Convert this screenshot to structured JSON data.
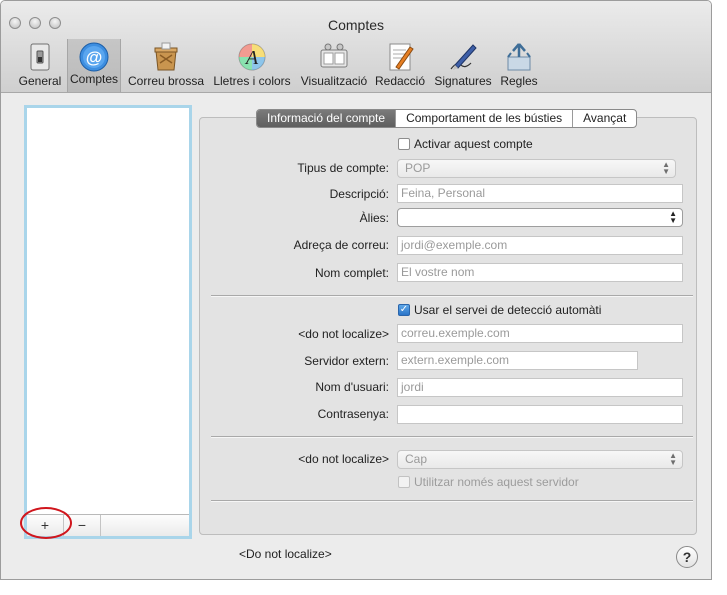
{
  "window": {
    "title": "Comptes"
  },
  "toolbar": {
    "items": [
      {
        "label": "General",
        "icon": "general-switch-icon"
      },
      {
        "label": "Comptes",
        "icon": "at-sign-icon"
      },
      {
        "label": "Correu brossa",
        "icon": "junk-bin-icon"
      },
      {
        "label": "Lletres i colors",
        "icon": "font-color-icon"
      },
      {
        "label": "Visualització",
        "icon": "viewing-icon"
      },
      {
        "label": "Redacció",
        "icon": "composing-icon"
      },
      {
        "label": "Signatures",
        "icon": "signature-pen-icon"
      },
      {
        "label": "Regles",
        "icon": "rules-icon"
      }
    ],
    "active": "Comptes"
  },
  "sidebar": {
    "add_label": "+",
    "remove_label": "−"
  },
  "tabs": {
    "items": [
      "Informació del compte",
      "Comportament de les bústies",
      "Avançat"
    ],
    "selected": "Informació del compte"
  },
  "form": {
    "enable_account_label": "Activar aquest compte",
    "account_type_label": "Tipus de compte:",
    "account_type_value": "POP",
    "description_label": "Descripció:",
    "description_placeholder": "Feina, Personal",
    "alias_label": "Àlies:",
    "alias_value": "",
    "email_label": "Adreça de correu:",
    "email_placeholder": "jordi@exemple.com",
    "fullname_label": "Nom complet:",
    "fullname_placeholder": "El vostre nom",
    "autodetect_label": "Usar el servei de detecció automàti",
    "incoming_label": "<do not localize>",
    "incoming_placeholder": "correu.exemple.com",
    "external_server_label": "Servidor extern:",
    "external_server_placeholder": "extern.exemple.com",
    "username_label": "Nom d'usuari:",
    "username_placeholder": "jordi",
    "password_label": "Contrasenya:",
    "password_value": "",
    "outgoing_label": "<do not localize>",
    "outgoing_value": "Cap",
    "only_server_label": "Utilitzar només aquest servidor"
  },
  "status": {
    "text": "<Do not localize>"
  },
  "help": {
    "label": "?"
  },
  "colors": {
    "selection_ring": "#a9d5ea",
    "annotation": "#d0161d",
    "checkbox_blue": "#2a74c8"
  }
}
